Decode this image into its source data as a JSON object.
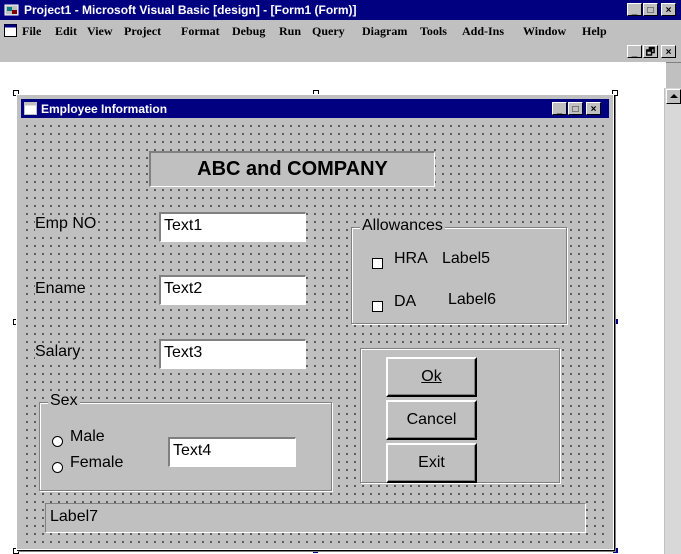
{
  "app": {
    "title": "Project1 - Microsoft Visual Basic [design] - [Form1 (Form)]",
    "controls": {
      "minimize": "_",
      "maximize": "□",
      "close": "×"
    }
  },
  "menu": [
    "File",
    "Edit",
    "View",
    "Project",
    "Format",
    "Debug",
    "Run",
    "Query",
    "Diagram",
    "Tools",
    "Add-Ins",
    "Window",
    "Help"
  ],
  "mdi_controls": {
    "minimize": "_",
    "restore": "🗗",
    "close": "×"
  },
  "form": {
    "title": "Employee Information",
    "heading": "ABC and COMPANY",
    "labels": {
      "emp_no": "Emp NO",
      "ename": "Ename",
      "salary": "Salary"
    },
    "textboxes": {
      "text1": "Text1",
      "text2": "Text2",
      "text3": "Text3",
      "text4": "Text4"
    },
    "allowances": {
      "caption": "Allowances",
      "hra": {
        "label": "HRA",
        "value": "Label5"
      },
      "da": {
        "label": "DA",
        "value": "Label6"
      }
    },
    "sex": {
      "caption": "Sex",
      "male": "Male",
      "female": "Female"
    },
    "buttons": {
      "ok": "Ok",
      "cancel": "Cancel",
      "exit": "Exit"
    },
    "footer_label": "Label7"
  }
}
